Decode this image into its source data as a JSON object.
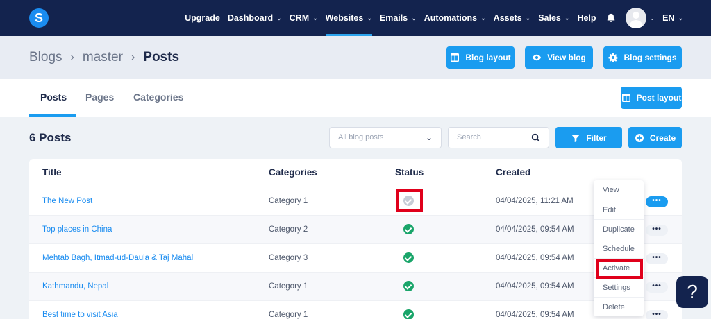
{
  "logo": "S",
  "nav": {
    "items": [
      {
        "label": "Upgrade",
        "chevron": false
      },
      {
        "label": "Dashboard",
        "chevron": true
      },
      {
        "label": "CRM",
        "chevron": true
      },
      {
        "label": "Websites",
        "chevron": true,
        "active": true
      },
      {
        "label": "Emails",
        "chevron": true
      },
      {
        "label": "Automations",
        "chevron": true
      },
      {
        "label": "Assets",
        "chevron": true
      },
      {
        "label": "Sales",
        "chevron": true
      },
      {
        "label": "Help",
        "chevron": false
      }
    ],
    "language": "EN"
  },
  "breadcrumb": [
    "Blogs",
    "master",
    "Posts"
  ],
  "header_buttons": {
    "blog_layout": "Blog layout",
    "view_blog": "View blog",
    "blog_settings": "Blog settings"
  },
  "tabs": [
    "Posts",
    "Pages",
    "Categories"
  ],
  "post_layout": "Post layout",
  "toolbar": {
    "count": "6 Posts",
    "filter_select": "All blog posts",
    "search_placeholder": "Search",
    "filter": "Filter",
    "create": "Create"
  },
  "table": {
    "headers": [
      "Title",
      "Categories",
      "Status",
      "Created"
    ],
    "rows": [
      {
        "title": "The New Post",
        "category": "Category 1",
        "status": "inactive",
        "created": "04/04/2025, 11:21 AM"
      },
      {
        "title": "Top places in China",
        "category": "Category 2",
        "status": "active",
        "created": "04/04/2025, 09:54 AM"
      },
      {
        "title": "Mehtab Bagh, Itmad-ud-Daula & Taj Mahal",
        "category": "Category 3",
        "status": "active",
        "created": "04/04/2025, 09:54 AM"
      },
      {
        "title": "Kathmandu, Nepal",
        "category": "Category 1",
        "status": "active",
        "created": "04/04/2025, 09:54 AM"
      },
      {
        "title": "Best time to visit Asia",
        "category": "Category 1",
        "status": "active",
        "created": "04/04/2025, 09:54 AM"
      }
    ],
    "more_label": "•••"
  },
  "row_menu": [
    "View",
    "Edit",
    "Duplicate",
    "Schedule",
    "Activate",
    "Settings",
    "Delete"
  ],
  "help_label": "?",
  "colors": {
    "nav_bg": "#13234e",
    "accent": "#1a9cf0",
    "highlight": "#e0001b",
    "status_active": "#1aa56a",
    "status_inactive": "#c6ccd6"
  }
}
